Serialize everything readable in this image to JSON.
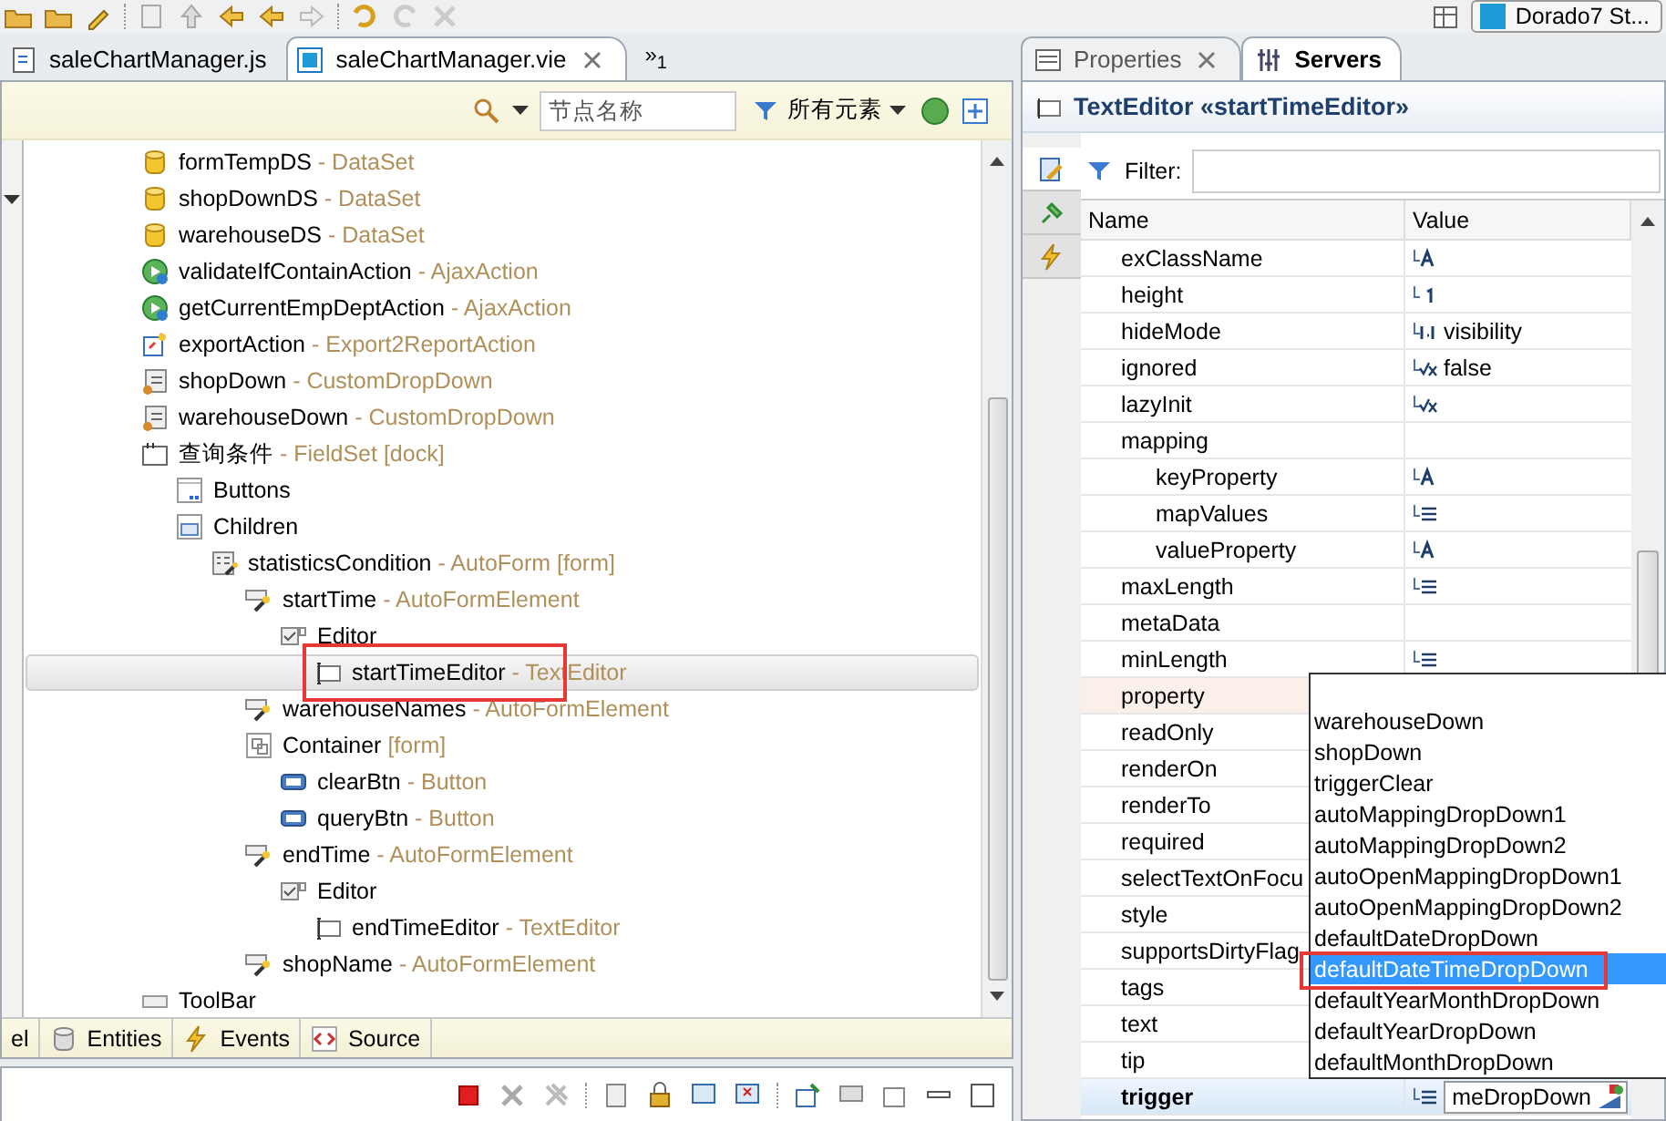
{
  "editor_tabs": [
    {
      "label": "saleChartManager.js",
      "kind": "js",
      "selected": false
    },
    {
      "label": "saleChartManager.vie",
      "kind": "view",
      "selected": true
    }
  ],
  "editor_overflow": {
    "symbol": "»",
    "count": "1"
  },
  "perspective": {
    "label": "Dorado7 St..."
  },
  "outline_toolbar": {
    "search_placeholder": "节点名称",
    "filter_label": "所有元素"
  },
  "tree": [
    {
      "name": "formTempDS",
      "suffix": "- DataSet",
      "kind": "dataset",
      "selected": false,
      "annotated": false
    },
    {
      "name": "shopDownDS",
      "suffix": "- DataSet",
      "kind": "dataset",
      "selected": false,
      "annotated": false
    },
    {
      "name": "warehouseDS",
      "suffix": "- DataSet",
      "kind": "dataset",
      "selected": false,
      "annotated": false
    },
    {
      "name": "validateIfContainAction",
      "suffix": "- AjaxAction",
      "kind": "action",
      "selected": false,
      "annotated": false
    },
    {
      "name": "getCurrentEmpDeptAction",
      "suffix": "- AjaxAction",
      "kind": "action",
      "selected": false,
      "annotated": false
    },
    {
      "name": "exportAction",
      "suffix": "- Export2ReportAction",
      "kind": "export",
      "selected": false,
      "annotated": false
    },
    {
      "name": "shopDown",
      "suffix": "- CustomDropDown",
      "kind": "dropdown",
      "selected": false,
      "annotated": false
    },
    {
      "name": "warehouseDown",
      "suffix": "- CustomDropDown",
      "kind": "dropdown",
      "selected": false,
      "annotated": false
    },
    {
      "name": "查询条件",
      "suffix": "- FieldSet [dock]",
      "kind": "fieldset",
      "selected": false,
      "annotated": false,
      "children": [
        {
          "name": "Buttons",
          "kind": "buttons",
          "selected": false,
          "annotated": false
        },
        {
          "name": "Children",
          "kind": "children",
          "selected": false,
          "annotated": false,
          "children": [
            {
              "name": "statisticsCondition",
              "suffix": "- AutoForm [form]",
              "kind": "autoform",
              "selected": false,
              "annotated": false,
              "children": [
                {
                  "name": "startTime",
                  "suffix": "- AutoFormElement",
                  "kind": "element",
                  "selected": false,
                  "annotated": false,
                  "children": [
                    {
                      "name": "Editor",
                      "kind": "editor",
                      "selected": false,
                      "annotated": false,
                      "children": [
                        {
                          "name": "startTimeEditor",
                          "suffix": "- TextEditor",
                          "kind": "texteditor",
                          "selected": true,
                          "annotated": true
                        }
                      ]
                    }
                  ]
                },
                {
                  "name": "warehouseNames",
                  "suffix": "- AutoFormElement",
                  "kind": "element",
                  "selected": false,
                  "annotated": false
                },
                {
                  "name": "Container",
                  "suffix": "[form]",
                  "kind": "container",
                  "selected": false,
                  "annotated": false,
                  "children": [
                    {
                      "name": "clearBtn",
                      "suffix": "- Button",
                      "kind": "button",
                      "selected": false,
                      "annotated": false
                    },
                    {
                      "name": "queryBtn",
                      "suffix": "- Button",
                      "kind": "button",
                      "selected": false,
                      "annotated": false
                    }
                  ]
                },
                {
                  "name": "endTime",
                  "suffix": "- AutoFormElement",
                  "kind": "element",
                  "selected": false,
                  "annotated": false,
                  "children": [
                    {
                      "name": "Editor",
                      "kind": "editor",
                      "selected": false,
                      "annotated": false,
                      "children": [
                        {
                          "name": "endTimeEditor",
                          "suffix": "- TextEditor",
                          "kind": "texteditor",
                          "selected": false,
                          "annotated": false
                        }
                      ]
                    }
                  ]
                },
                {
                  "name": "shopName",
                  "suffix": "- AutoFormElement",
                  "kind": "element",
                  "selected": false,
                  "annotated": false
                }
              ]
            }
          ]
        }
      ]
    },
    {
      "name": "ToolBar",
      "kind": "toolbar",
      "selected": false,
      "annotated": false
    }
  ],
  "bottom_tabs": [
    {
      "label": "el",
      "kind": "none",
      "selected": false
    },
    {
      "label": "Entities",
      "kind": "entities",
      "selected": false
    },
    {
      "label": "Events",
      "kind": "events",
      "selected": false
    },
    {
      "label": "Source",
      "kind": "source",
      "selected": false
    }
  ],
  "properties_view": {
    "tabs": [
      {
        "label": "Properties",
        "selected": false,
        "closable": true,
        "kind": "properties"
      },
      {
        "label": "Servers",
        "selected": true,
        "closable": false,
        "kind": "servers"
      }
    ],
    "title": "TextEditor «startTimeEditor»",
    "side_tabs": [
      {
        "kind": "edit",
        "selected": true
      },
      {
        "kind": "pin",
        "selected": false
      },
      {
        "kind": "events",
        "selected": false
      }
    ],
    "filter_label": "Filter:",
    "columns": [
      "Name",
      "Value"
    ],
    "rows": [
      {
        "name": "exClassName",
        "kind": "text",
        "selected": false,
        "hovered": false
      },
      {
        "name": "height",
        "kind": "number",
        "selected": false,
        "hovered": false
      },
      {
        "name": "hideMode",
        "kind": "enum",
        "value": "visibility",
        "selected": false,
        "hovered": false
      },
      {
        "name": "ignored",
        "kind": "bool",
        "value": "false",
        "selected": false,
        "hovered": false
      },
      {
        "name": "lazyInit",
        "kind": "bool",
        "selected": false,
        "hovered": false
      },
      {
        "name": "mapping",
        "kind": "none",
        "selected": false,
        "hovered": false,
        "children": [
          {
            "name": "keyProperty",
            "kind": "text",
            "selected": false,
            "hovered": false
          },
          {
            "name": "mapValues",
            "kind": "list",
            "selected": false,
            "hovered": false
          },
          {
            "name": "valueProperty",
            "kind": "text",
            "selected": false,
            "hovered": false
          }
        ]
      },
      {
        "name": "maxLength",
        "kind": "list",
        "selected": false,
        "hovered": false
      },
      {
        "name": "metaData",
        "kind": "none",
        "selected": false,
        "hovered": false
      },
      {
        "name": "minLength",
        "kind": "list",
        "selected": false,
        "hovered": false
      },
      {
        "name": "property",
        "kind": "none",
        "selected": false,
        "hovered": true
      },
      {
        "name": "readOnly",
        "kind": "none",
        "selected": false,
        "hovered": false
      },
      {
        "name": "renderOn",
        "kind": "none",
        "selected": false,
        "hovered": false
      },
      {
        "name": "renderTo",
        "kind": "none",
        "selected": false,
        "hovered": false
      },
      {
        "name": "required",
        "kind": "none",
        "selected": false,
        "hovered": false
      },
      {
        "name": "selectTextOnFocu",
        "kind": "none",
        "selected": false,
        "hovered": false
      },
      {
        "name": "style",
        "kind": "none",
        "selected": false,
        "hovered": false
      },
      {
        "name": "supportsDirtyFlag",
        "kind": "none",
        "selected": false,
        "hovered": false
      },
      {
        "name": "tags",
        "kind": "none",
        "selected": false,
        "hovered": false
      },
      {
        "name": "text",
        "kind": "none",
        "selected": false,
        "hovered": false
      },
      {
        "name": "tip",
        "kind": "none",
        "selected": false,
        "hovered": false
      },
      {
        "name": "trigger",
        "kind": "editing",
        "value": "meDropDown",
        "selected": true,
        "hovered": false
      }
    ],
    "dropdown_options": [
      {
        "label": "warehouseDown",
        "selected": false,
        "annotated": false
      },
      {
        "label": "shopDown",
        "selected": false,
        "annotated": false
      },
      {
        "label": "triggerClear",
        "selected": false,
        "annotated": false
      },
      {
        "label": "autoMappingDropDown1",
        "selected": false,
        "annotated": false
      },
      {
        "label": "autoMappingDropDown2",
        "selected": false,
        "annotated": false
      },
      {
        "label": "autoOpenMappingDropDown1",
        "selected": false,
        "annotated": false
      },
      {
        "label": "autoOpenMappingDropDown2",
        "selected": false,
        "annotated": false
      },
      {
        "label": "defaultDateDropDown",
        "selected": false,
        "annotated": false
      },
      {
        "label": "defaultDateTimeDropDown",
        "selected": true,
        "annotated": true
      },
      {
        "label": "defaultYearMonthDropDown",
        "selected": false,
        "annotated": false
      },
      {
        "label": "defaultYearDropDown",
        "selected": false,
        "annotated": false
      },
      {
        "label": "defaultMonthDropDown",
        "selected": false,
        "annotated": false
      }
    ]
  }
}
